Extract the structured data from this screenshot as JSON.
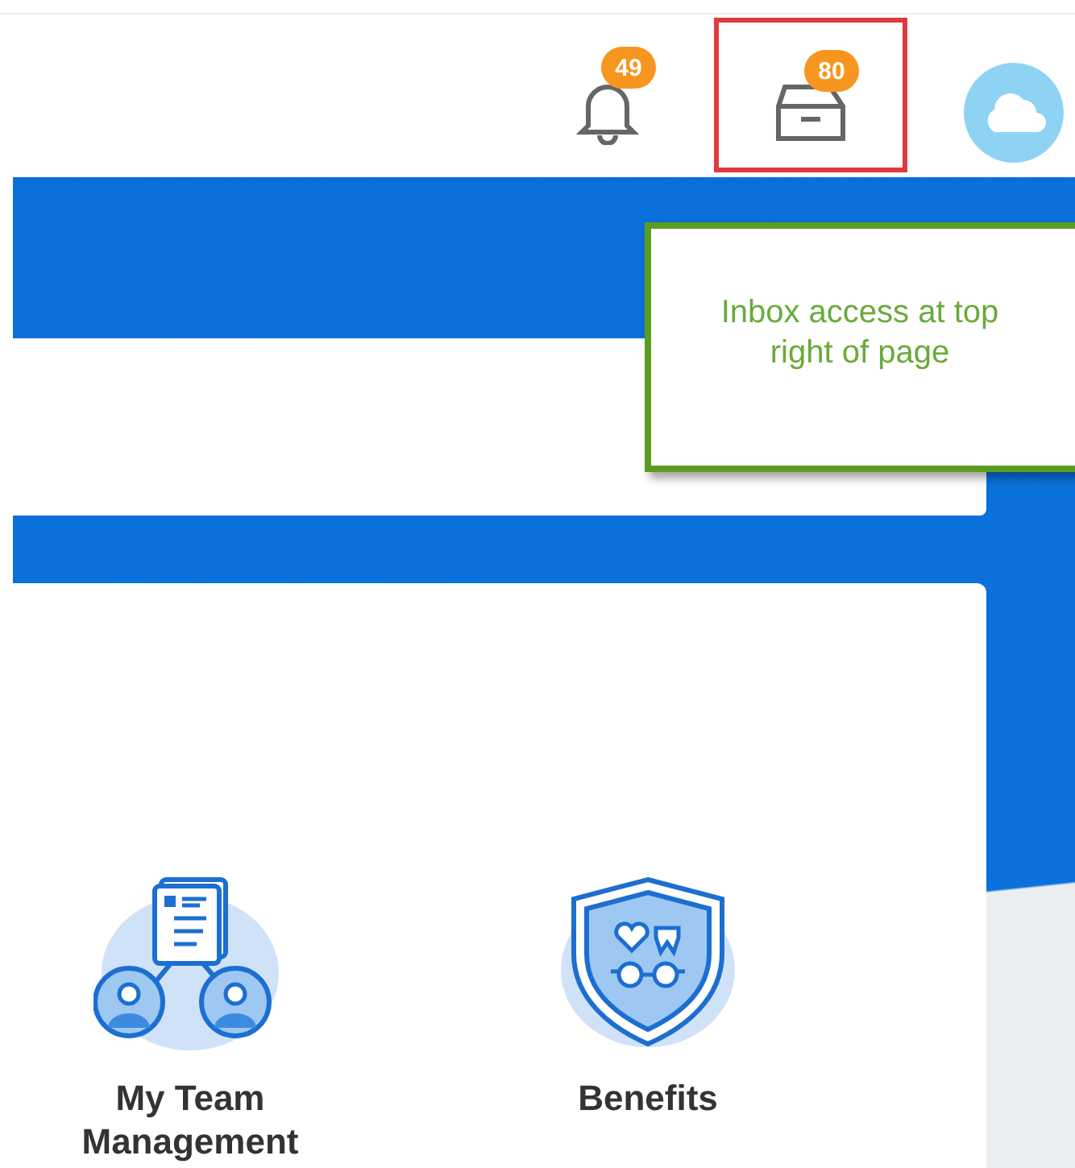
{
  "header": {
    "notifications": {
      "badge": "49"
    },
    "inbox": {
      "badge": "80",
      "highlighted": true
    }
  },
  "callout": {
    "text": "Inbox access at top right of page"
  },
  "apps": [
    {
      "kind": "team",
      "label": "My Team Management"
    },
    {
      "kind": "benefits",
      "label": "Benefits"
    }
  ]
}
